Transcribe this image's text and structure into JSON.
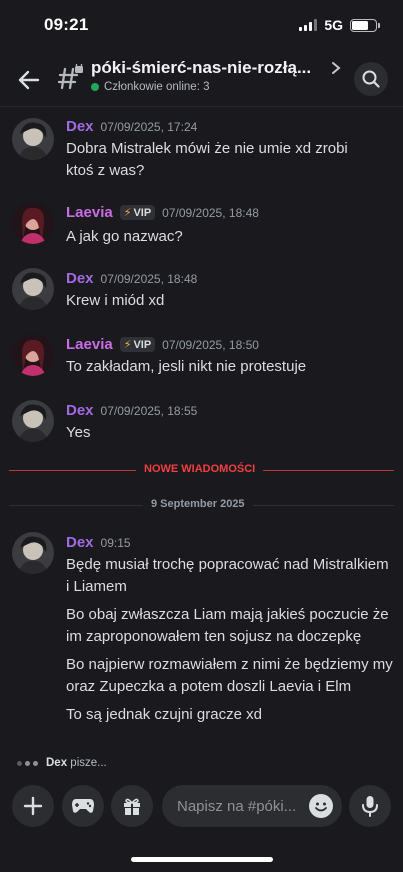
{
  "status_bar": {
    "time": "09:21",
    "network": "5G"
  },
  "header": {
    "channel_name": "póki-śmierć-nas-nie-rozłą...",
    "online_text": "Członkowie online: 3",
    "back_icon": "arrow-left-icon",
    "channel_icon": "hashtag-thread-icon",
    "search_icon": "search-icon"
  },
  "messages": [
    {
      "author": "Dex",
      "timestamp": "07/09/2025, 17:24",
      "vip": false,
      "lines": [
        "Dobra Mistralek mówi że nie umie xd zrobi",
        "ktoś z was?"
      ]
    },
    {
      "author": "Laevia",
      "timestamp": "07/09/2025, 18:48",
      "vip": true,
      "vip_label": "VIP",
      "lines": [
        "A jak go nazwac?"
      ]
    },
    {
      "author": "Dex",
      "timestamp": "07/09/2025, 18:48",
      "vip": false,
      "lines": [
        "Krew i miód xd"
      ]
    },
    {
      "author": "Laevia",
      "timestamp": "07/09/2025, 18:50",
      "vip": true,
      "vip_label": "VIP",
      "lines": [
        "To zakładam, jesli nikt nie protestuje"
      ]
    },
    {
      "author": "Dex",
      "timestamp": "07/09/2025, 18:55",
      "vip": false,
      "lines": [
        "Yes"
      ]
    }
  ],
  "new_messages_label": "NOWE WIADOMOŚCI",
  "date_divider": "9 September 2025",
  "latest_message": {
    "author": "Dex",
    "timestamp": "09:15",
    "paragraphs": [
      "Będę musiał trochę popracować nad Mistralkiem i Liamem",
      "Bo obaj zwłaszcza Liam mają jakieś poczucie że im zaproponowałem ten sojusz na doczepkę",
      "Bo najpierw rozmawiałem z nimi że będziemy my oraz Zupeczka a potem doszli Laevia i Elm",
      "To są jednak czujni gracze xd"
    ]
  },
  "typing": {
    "user": "Dex",
    "suffix": " pisze..."
  },
  "composer": {
    "placeholder": "Napisz na #póki...",
    "buttons": [
      "plus-icon",
      "gamepad-icon",
      "gift-icon",
      "emoji-icon",
      "microphone-icon"
    ]
  },
  "colors": {
    "background": "#1a1a1e",
    "dex": "#a36ae0",
    "laevia": "#c86de5",
    "new_messages": "#f23f43",
    "online": "#23a55a"
  }
}
